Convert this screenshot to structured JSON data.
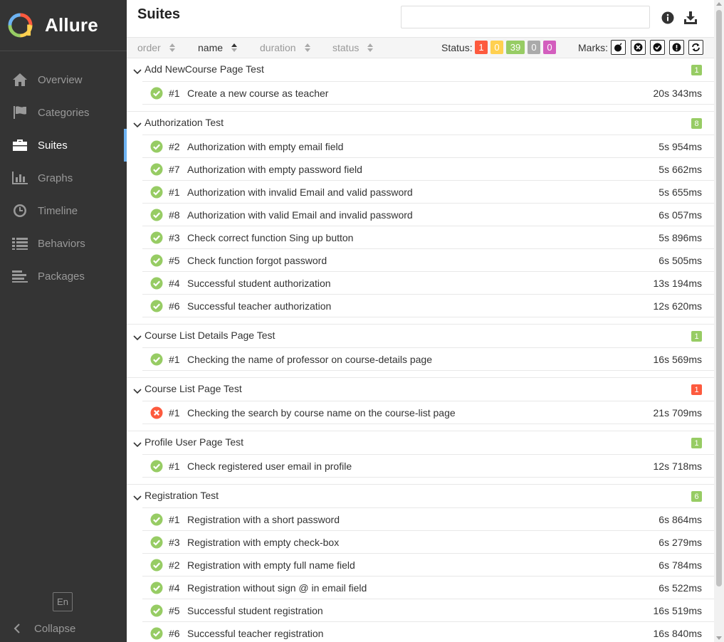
{
  "app": {
    "name": "Allure"
  },
  "sidebar": {
    "items": [
      {
        "label": "Overview",
        "icon": "home-icon",
        "active": false
      },
      {
        "label": "Categories",
        "icon": "flag-icon",
        "active": false
      },
      {
        "label": "Suites",
        "icon": "briefcase-icon",
        "active": true
      },
      {
        "label": "Graphs",
        "icon": "bar-chart-icon",
        "active": false
      },
      {
        "label": "Timeline",
        "icon": "clock-icon",
        "active": false
      },
      {
        "label": "Behaviors",
        "icon": "list-icon",
        "active": false
      },
      {
        "label": "Packages",
        "icon": "align-left-icon",
        "active": false
      }
    ],
    "language": "En",
    "collapse_label": "Collapse"
  },
  "header": {
    "title": "Suites",
    "search_placeholder": ""
  },
  "toolbar": {
    "sort": {
      "order": "order",
      "name": "name",
      "duration": "duration",
      "status": "status"
    },
    "status_label": "Status:",
    "status_counts": [
      {
        "value": "1",
        "color": "#fd5a3e"
      },
      {
        "value": "0",
        "color": "#ffd050"
      },
      {
        "value": "39",
        "color": "#97cc64"
      },
      {
        "value": "0",
        "color": "#aaaaaa"
      },
      {
        "value": "0",
        "color": "#d35ebe"
      }
    ],
    "marks_label": "Marks:"
  },
  "colors": {
    "passed": "#97cc64",
    "failed": "#fd5a3e",
    "accent": "#6db3f2",
    "sidebar_bg": "#343434"
  },
  "groups": [
    {
      "name": "Add NewCourse Page Test",
      "count": "1",
      "status": "passed",
      "tests": [
        {
          "num": "#1",
          "name": "Create a new course as teacher",
          "duration": "20s 343ms",
          "status": "passed"
        }
      ]
    },
    {
      "name": "Authorization Test",
      "count": "8",
      "status": "passed",
      "tests": [
        {
          "num": "#2",
          "name": "Authorization with empty email field",
          "duration": "5s 954ms",
          "status": "passed"
        },
        {
          "num": "#7",
          "name": "Authorization with empty password field",
          "duration": "5s 662ms",
          "status": "passed"
        },
        {
          "num": "#1",
          "name": "Authorization with invalid Email and valid password",
          "duration": "5s 655ms",
          "status": "passed"
        },
        {
          "num": "#8",
          "name": "Authorization with valid Email and invalid password",
          "duration": "6s 057ms",
          "status": "passed"
        },
        {
          "num": "#3",
          "name": "Check correct function Sing up button",
          "duration": "5s 896ms",
          "status": "passed"
        },
        {
          "num": "#5",
          "name": "Check function forgot password",
          "duration": "6s 505ms",
          "status": "passed"
        },
        {
          "num": "#4",
          "name": "Successful student authorization",
          "duration": "13s 194ms",
          "status": "passed"
        },
        {
          "num": "#6",
          "name": "Successful teacher authorization",
          "duration": "12s 620ms",
          "status": "passed"
        }
      ]
    },
    {
      "name": "Course List Details Page Test",
      "count": "1",
      "status": "passed",
      "tests": [
        {
          "num": "#1",
          "name": "Checking the name of professor on course-details page",
          "duration": "16s 569ms",
          "status": "passed"
        }
      ]
    },
    {
      "name": "Course List Page Test",
      "count": "1",
      "status": "failed",
      "tests": [
        {
          "num": "#1",
          "name": "Checking the search by course name on the course-list page",
          "duration": "21s 709ms",
          "status": "failed"
        }
      ]
    },
    {
      "name": "Profile User Page Test",
      "count": "1",
      "status": "passed",
      "tests": [
        {
          "num": "#1",
          "name": "Check registered user email in profile",
          "duration": "12s 718ms",
          "status": "passed"
        }
      ]
    },
    {
      "name": "Registration Test",
      "count": "6",
      "status": "passed",
      "tests": [
        {
          "num": "#1",
          "name": "Registration with a short password",
          "duration": "6s 864ms",
          "status": "passed"
        },
        {
          "num": "#3",
          "name": "Registration with empty check-box",
          "duration": "6s 279ms",
          "status": "passed"
        },
        {
          "num": "#2",
          "name": "Registration with empty full name field",
          "duration": "6s 784ms",
          "status": "passed"
        },
        {
          "num": "#4",
          "name": "Registration without sign @ in email field",
          "duration": "6s 522ms",
          "status": "passed"
        },
        {
          "num": "#5",
          "name": "Successful student registration",
          "duration": "16s 519ms",
          "status": "passed"
        },
        {
          "num": "#6",
          "name": "Successful teacher registration",
          "duration": "16s 840ms",
          "status": "passed"
        }
      ]
    }
  ]
}
